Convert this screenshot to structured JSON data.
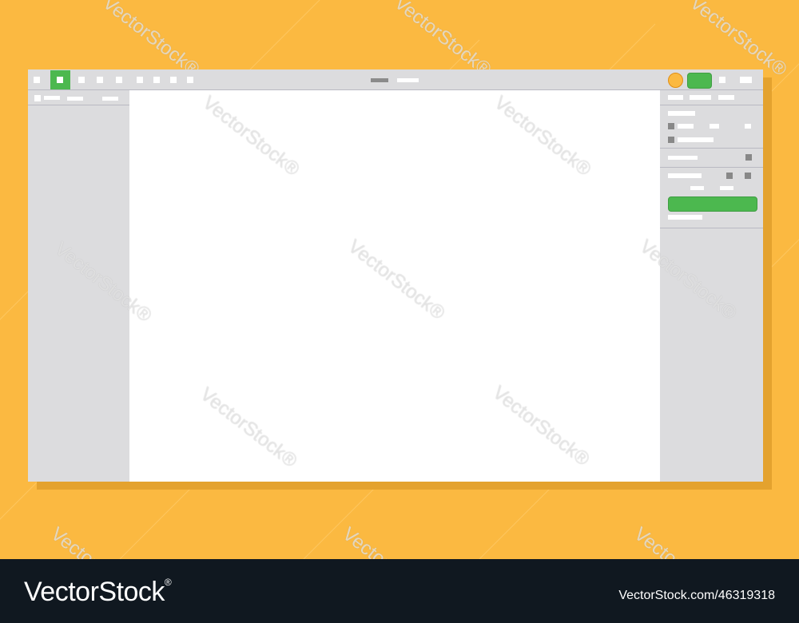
{
  "colors": {
    "background": "#FBB941",
    "window": "#DCDCDE",
    "canvas": "#FFFFFF",
    "accent_green": "#4CB84F",
    "avatar": "#FBB941",
    "footer": "#101820"
  },
  "toolbar": {
    "tool_icons": [
      "square-tool-icon",
      "active-tool-icon",
      "square-tool-icon",
      "square-tool-icon",
      "square-tool-icon",
      "square-tool-icon",
      "square-tool-icon",
      "square-tool-icon",
      "square-tool-icon"
    ],
    "right_icons": [
      "avatar",
      "share-button",
      "square-icon",
      "menu-icon"
    ]
  },
  "watermark": {
    "text": "VectorStock",
    "reg": "®"
  },
  "footer": {
    "brand": "VectorStock",
    "brand_reg": "®",
    "stock_id": "VectorStock.com/46319318"
  }
}
